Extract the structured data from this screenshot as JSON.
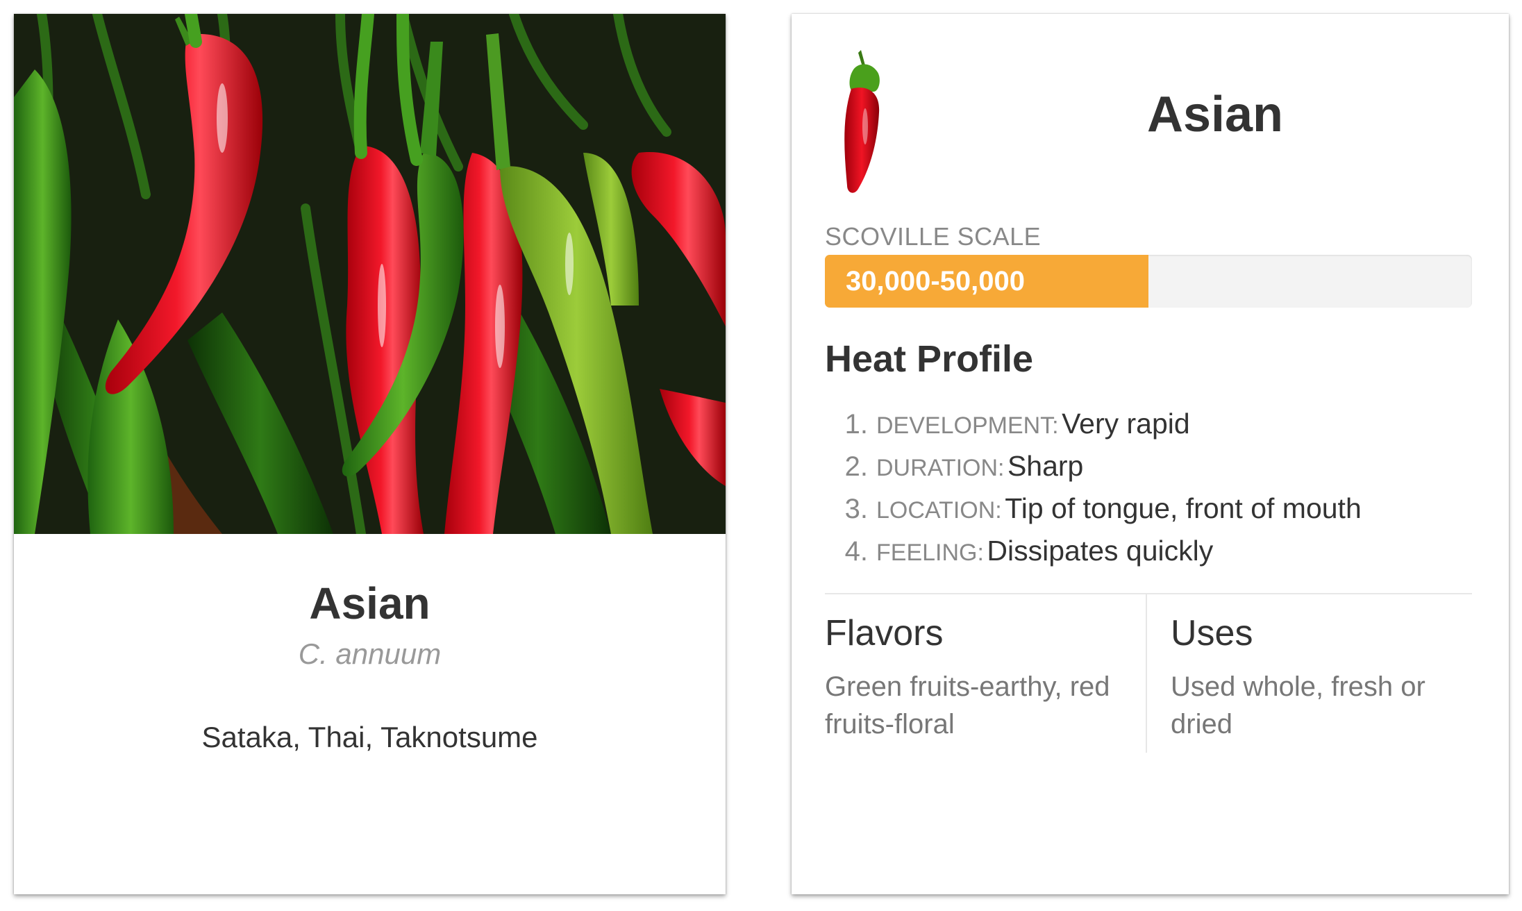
{
  "left_card": {
    "name": "Asian",
    "species": "C. annuum",
    "aliases": "Sataka, Thai, Taknotsume"
  },
  "right_card": {
    "name": "Asian",
    "icon": "red-chili-pepper-icon",
    "scoville": {
      "label": "SCOVILLE SCALE",
      "value": "30,000-50,000",
      "fill_fraction": 0.5
    },
    "heat_profile": {
      "title": "Heat Profile",
      "items": [
        {
          "num": "1.",
          "key": "DEVELOPMENT:",
          "value": "Very rapid"
        },
        {
          "num": "2.",
          "key": "DURATION:",
          "value": "Sharp"
        },
        {
          "num": "3.",
          "key": "LOCATION:",
          "value": "Tip of tongue, front of mouth"
        },
        {
          "num": "4.",
          "key": "FEELING:",
          "value": "Dissipates quickly"
        }
      ]
    },
    "flavors": {
      "title": "Flavors",
      "text": "Green fruits-earthy, red fruits-floral"
    },
    "uses": {
      "title": "Uses",
      "text": "Used whole, fresh or dried"
    }
  },
  "colors": {
    "accent_orange": "#f7a937",
    "pepper_red": "#e0101e",
    "pepper_green": "#4a9a1c",
    "text_dark": "#333333",
    "text_muted": "#888888"
  }
}
